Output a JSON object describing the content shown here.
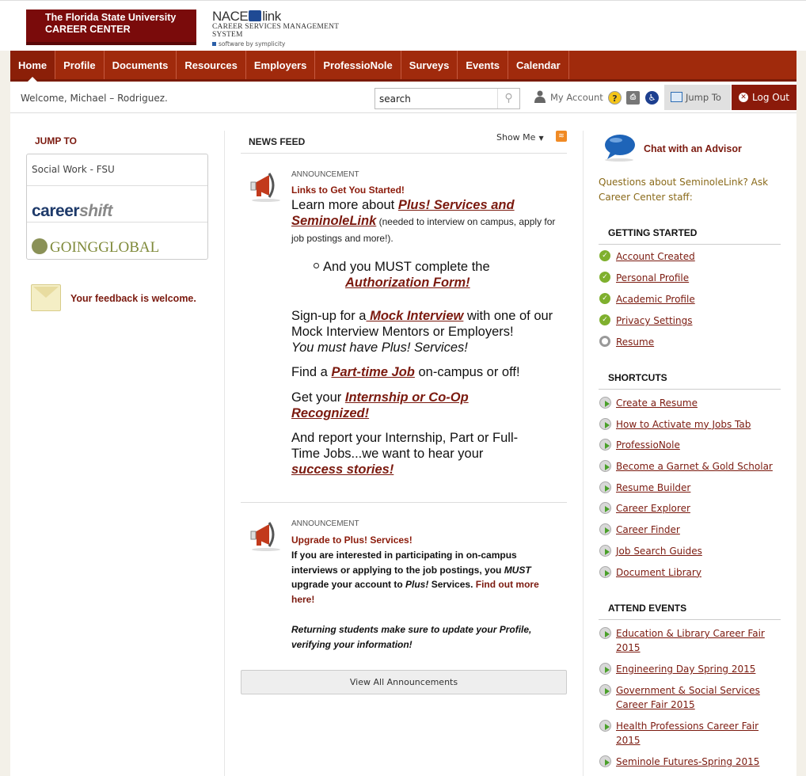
{
  "header": {
    "fsu_logo_line1": "The Florida State University",
    "fsu_logo_line2": "CAREER CENTER",
    "nace_logo_main": "NACE",
    "nace_logo_link": "link",
    "nace_logo_sub": "CAREER SERVICES MANAGEMENT SYSTEM",
    "nace_logo_by": "software by symplicity"
  },
  "nav": {
    "items": [
      "Home",
      "Profile",
      "Documents",
      "Resources",
      "Employers",
      "ProfessioNole",
      "Surveys",
      "Events",
      "Calendar"
    ],
    "active": "Home"
  },
  "utility": {
    "welcome": "Welcome, Michael – Rodriguez.",
    "search_value": "search",
    "my_account": "My Account",
    "help_icon": "?",
    "jump_to": "Jump To",
    "logout": "Log Out"
  },
  "left": {
    "jump_to_title": "JUMP TO",
    "jump_items": [
      "Social Work - FSU"
    ],
    "careershift_a": "career",
    "careershift_b": "shift",
    "goingglobal": "GOINGGLOBAL",
    "feedback": "Your feedback is welcome."
  },
  "news": {
    "title": "NEWS FEED",
    "show_me": "Show Me",
    "ann1": {
      "kicker": "ANNOUNCEMENT",
      "title": "Links to Get You Started!",
      "p1_pre": "Learn more about ",
      "p1_link": "Plus! Services and SeminoleLink",
      "p1_post": " (needed to interview on campus, apply for job postings and more!).",
      "bullet_pre": "And you MUST complete the ",
      "bullet_link": "Authorization Form!",
      "p2_pre": "Sign-up for a",
      "p2_link": " Mock Interview",
      "p2_post": " with one of our Mock Interview Mentors or Employers!",
      "p2_italic": "You must have Plus! Services!",
      "p3_pre": "Find a ",
      "p3_link": "Part-time Job",
      "p3_post": " on-campus or off!",
      "p4_pre": "Get your ",
      "p4_link": "Internship or Co-Op Recognized!",
      "p5_pre": "And report your Internship, Part or Full-Time Jobs...we want to hear your ",
      "p5_link": "success stories!"
    },
    "ann2": {
      "kicker": "ANNOUNCEMENT",
      "title": "Upgrade to Plus! Services!",
      "body_1": "If you are interested in participating in on-campus interviews or applying to the job postings, you ",
      "body_must": "MUST",
      "body_2": " upgrade your account to ",
      "body_plus": "Plus!",
      "body_3": " Services.  ",
      "body_link": "Find out more here!",
      "note": "Returning students make sure to update your Profile, verifying your information!"
    },
    "view_all": "View All Announcements"
  },
  "right": {
    "chat_title": "Chat with an Advisor",
    "chat_sub": "Questions about SeminoleLink? Ask Career Center staff:",
    "getting_started_title": "GETTING STARTED",
    "getting_started": [
      {
        "label": "Account Created",
        "done": true
      },
      {
        "label": "Personal Profile",
        "done": true
      },
      {
        "label": "Academic Profile",
        "done": true
      },
      {
        "label": "Privacy Settings",
        "done": true
      },
      {
        "label": "Resume",
        "done": false
      }
    ],
    "shortcuts_title": "SHORTCUTS",
    "shortcuts": [
      "Create a Resume",
      "How to Activate my Jobs Tab",
      "ProfessioNole",
      "Become a Garnet & Gold Scholar",
      "Resume Builder",
      "Career Explorer",
      "Career Finder",
      "Job Search Guides",
      "Document Library"
    ],
    "events_title": "ATTEND EVENTS",
    "events": [
      "Education & Library Career Fair 2015",
      "Engineering Day Spring 2015",
      "Government & Social Services Career Fair 2015",
      "Health Professions Career Fair 2015",
      "Seminole Futures-Spring 2015"
    ]
  },
  "colors": {
    "garnet": "#a02a0c",
    "link": "#7b1a0f",
    "accent_gold": "#8a6a1a",
    "check_green": "#7fb02e"
  }
}
